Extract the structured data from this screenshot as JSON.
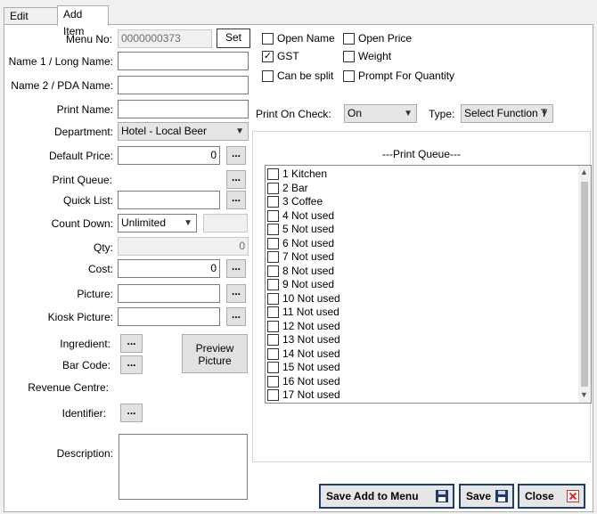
{
  "tabs": [
    {
      "label": "Edit Items"
    },
    {
      "label": "Add Item"
    }
  ],
  "form": {
    "menu_no": {
      "label": "Menu No:",
      "value": "0000000373",
      "set_label": "Set"
    },
    "name1": {
      "label": "Name 1 / Long Name:",
      "value": ""
    },
    "name2": {
      "label": "Name 2 / PDA Name:",
      "value": ""
    },
    "print_name": {
      "label": "Print Name:",
      "value": ""
    },
    "department": {
      "label": "Department:",
      "value": "Hotel - Local Beer"
    },
    "default_price": {
      "label": "Default Price:",
      "value": "0"
    },
    "print_queue": {
      "label": "Print Queue:"
    },
    "quick_list": {
      "label": "Quick List:",
      "value": ""
    },
    "count_down": {
      "label": "Count Down:",
      "value": "Unlimited",
      "extra": ""
    },
    "qty": {
      "label": "Qty:",
      "value": "0"
    },
    "cost": {
      "label": "Cost:",
      "value": "0"
    },
    "picture": {
      "label": "Picture:",
      "value": ""
    },
    "kiosk_picture": {
      "label": "Kiosk Picture:",
      "value": ""
    },
    "ingredient": {
      "label": "Ingredient:"
    },
    "bar_code": {
      "label": "Bar Code:"
    },
    "revenue_centre": {
      "label": "Revenue Centre:"
    },
    "identifier": {
      "label": "Identifier:"
    },
    "description": {
      "label": "Description:",
      "value": ""
    },
    "dots": "...",
    "preview_picture": "Preview Picture"
  },
  "options": {
    "open_name": {
      "label": "Open Name",
      "checked": false
    },
    "open_price": {
      "label": "Open Price",
      "checked": false
    },
    "gst": {
      "label": "GST",
      "checked": true
    },
    "weight": {
      "label": "Weight",
      "checked": false
    },
    "can_be_split": {
      "label": "Can be split",
      "checked": false
    },
    "prompt_qty": {
      "label": "Prompt For Quantity",
      "checked": false
    }
  },
  "print_on_check": {
    "label": "Print On Check:",
    "value": "On"
  },
  "type": {
    "label": "Type:",
    "value": "Select Function T"
  },
  "print_queue_panel": {
    "title": "---Print Queue---",
    "items": [
      "1 Kitchen",
      "2 Bar",
      "3 Coffee",
      "4 Not used",
      "5 Not used",
      "6 Not used",
      "7 Not used",
      "8 Not used",
      "9 Not used",
      "10 Not used",
      "11 Not used",
      "12 Not used",
      "13 Not used",
      "14 Not used",
      "15 Not used",
      "16 Not used",
      "17 Not used"
    ]
  },
  "footer": {
    "save_add_label": "Save Add to Menu",
    "save_label": "Save",
    "close_label": "Close"
  },
  "icons": {
    "save": "floppy-disk-icon",
    "close": "red-x-icon",
    "check": "✓",
    "dropdown": "chevron-down-icon"
  },
  "colors": {
    "accent_border": "#1e3f6e",
    "close_red": "#d32f2f"
  }
}
